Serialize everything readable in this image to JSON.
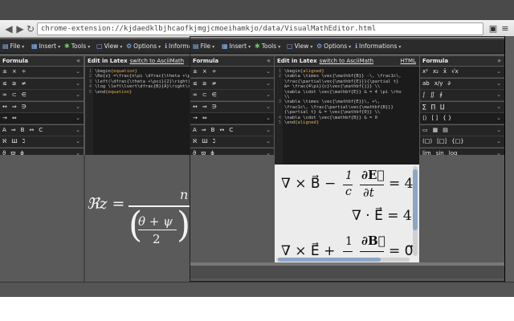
{
  "browser": {
    "url": "chrome-extension://kjdaedklbjhcaofkjmgjcmoeihamkjo/data/VisualMathEditor.html",
    "back_glyph": "◀",
    "forward_glyph": "▶",
    "reload_glyph": "↻"
  },
  "menu": {
    "file": "File",
    "insert": "Insert",
    "tools": "Tools",
    "view": "View",
    "options": "Options",
    "informations": "Informations",
    "informations_short": "Informat"
  },
  "left_window": {
    "formula_title": "Formula",
    "edit_title": "Edit in Latex",
    "switch_link": "switch to AsciiMath",
    "rows": [
      {
        "symbols": [
          "±",
          "×",
          "÷"
        ]
      },
      {
        "symbols": [
          "≤",
          "≥",
          "≠"
        ]
      },
      {
        "symbols": [
          "∞",
          "⊂",
          "∈"
        ]
      },
      {
        "symbols": [
          "↔",
          "⇒",
          "∋"
        ]
      },
      {
        "symbols": [
          "→",
          "⇔"
        ]
      },
      {
        "symbols": [
          "A",
          "⇒",
          "B",
          "↔",
          "C"
        ]
      },
      {
        "symbols": [
          "ℵ",
          "Ш",
          "ℷ"
        ]
      },
      {
        "symbols": [
          "ϑ",
          "ϖ",
          "ϕ"
        ]
      }
    ],
    "code_lines": [
      "\\begin{equation}",
      "\\Re{z} =\\frac{n\\pi \\dfrac{\\theta +\\psi}{2}}{",
      "\\left(\\dfrac{\\theta +\\psi}{2}\\right)^2 + \\left(",
      "\\log \\left\\lvert\\dfrac{B}{A}\\right\\rvert\\right",
      "\\end{equation}"
    ],
    "preview": {
      "lhs": "ℜz =",
      "numerator_fragment": "n",
      "den_numerator": "θ + ψ",
      "den_denominator": "2"
    }
  },
  "right_window": {
    "formula_title": "Formula",
    "edit_title": "Edit in Latex",
    "switch_link": "switch to AsciiMath",
    "html_link": "HTML",
    "symbols_title": "Formula",
    "rows": [
      {
        "symbols": [
          "±",
          "×",
          "÷"
        ]
      },
      {
        "symbols": [
          "≤",
          "≥",
          "≠"
        ]
      },
      {
        "symbols": [
          "∞",
          "⊂",
          "∈"
        ]
      },
      {
        "symbols": [
          "↔",
          "⇒",
          "∋"
        ]
      },
      {
        "symbols": [
          "→",
          "⇔"
        ]
      },
      {
        "symbols": [
          "A",
          "⇒",
          "B",
          "↔",
          "C"
        ]
      },
      {
        "symbols": [
          "ℵ",
          "Ш",
          "ℷ"
        ]
      },
      {
        "symbols": [
          "ϑ",
          "ϖ",
          "ϕ"
        ]
      }
    ],
    "symbol_rows": [
      {
        "symbols": [
          "x²",
          "x₂",
          "x̄",
          "√x"
        ]
      },
      {
        "symbols": [
          "ab",
          "x/y",
          "∂"
        ]
      },
      {
        "symbols": [
          "∫",
          "∬",
          "∮"
        ]
      },
      {
        "symbols": [
          "∑",
          "∏",
          "∐"
        ]
      },
      {
        "symbols": [
          "⟨⟩",
          "[ ]",
          "{ }"
        ]
      },
      {
        "symbols": [
          "▭",
          "▦",
          "▤"
        ]
      },
      {
        "symbols": [
          "(□)",
          "[□]",
          "{□}"
        ]
      },
      {
        "symbols": [
          "lim",
          "sin",
          "log"
        ]
      }
    ],
    "code_lines": [
      "\\begin{aligned}",
      "\\nabla \\times \\vec{\\mathbf{B}} -\\, \\frac1c\\,",
      "\\frac{\\partial\\vec{\\mathbf{E}}}{\\partial t}",
      "&= \\frac{4\\pi}{c}\\vec{\\mathbf{j}} \\\\",
      "\\nabla \\cdot \\vec{\\mathbf{E}} & = 4 \\pi \\rho",
      "\\\\",
      "\\nabla \\times \\vec{\\mathbf{E}}\\, +\\,",
      "\\frac1c\\, \\frac{\\partial\\vec{\\mathbf{B}}}",
      "{\\partial t} & = \\vec{\\mathbf{0}} \\\\",
      "\\nabla \\cdot \\vec{\\mathbf{B}} & = 0",
      "\\end{aligned}"
    ],
    "preview": {
      "line1_lhs": "∇ × B⃗ −",
      "line1_frac_num": "1",
      "line1_frac_den": "c",
      "line1_frac2_num": "∂E⃗",
      "line1_frac2_den": "∂t",
      "line1_rhs": "= 4",
      "line2": "∇ · E⃗ = 4",
      "line3_lhs": "∇ × E⃗ +",
      "line3_frac_num": "1",
      "line3_frac2_num": "∂B⃗",
      "line3_rhs": "= 0⃗"
    }
  },
  "colors": {
    "panel_bg": "#252525",
    "preview_bg": "#5a5a5a",
    "preview_light_bg": "#ececec",
    "keyword": "#e0b050"
  }
}
